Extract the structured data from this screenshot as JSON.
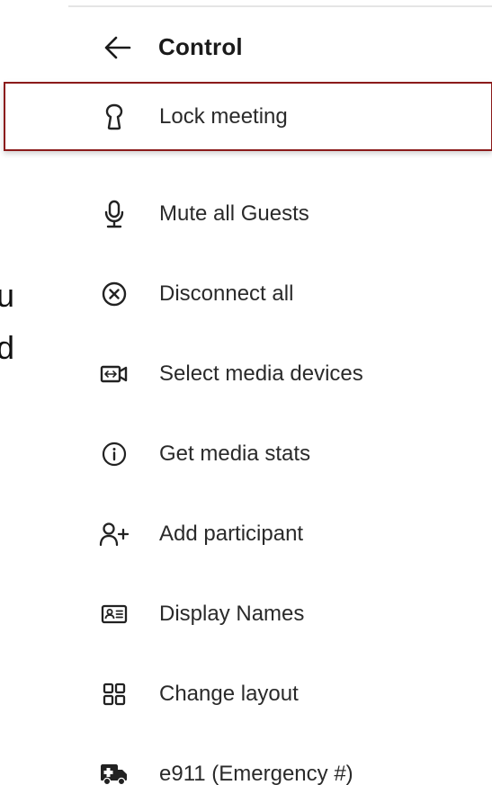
{
  "background": {
    "fragments": [
      "u",
      "d"
    ]
  },
  "header": {
    "back_icon": "arrow-left-icon",
    "title": "Control"
  },
  "menu": {
    "items": [
      {
        "label": "Lock meeting",
        "icon": "keyhole-icon",
        "selected": true
      },
      {
        "label": "Mute all Guests",
        "icon": "microphone-icon"
      },
      {
        "label": "Disconnect all",
        "icon": "close-circle-icon"
      },
      {
        "label": "Select media devices",
        "icon": "camera-switch-icon"
      },
      {
        "label": "Get media stats",
        "icon": "info-circle-icon"
      },
      {
        "label": "Add participant",
        "icon": "add-person-icon"
      },
      {
        "label": "Display Names",
        "icon": "id-card-icon"
      },
      {
        "label": "Change layout",
        "icon": "grid-layout-icon"
      },
      {
        "label": "e911 (Emergency #)",
        "icon": "ambulance-icon"
      }
    ]
  },
  "colors": {
    "selected_border": "#8b1a1a",
    "text": "#2a2a2a",
    "title": "#1a1a1a"
  }
}
